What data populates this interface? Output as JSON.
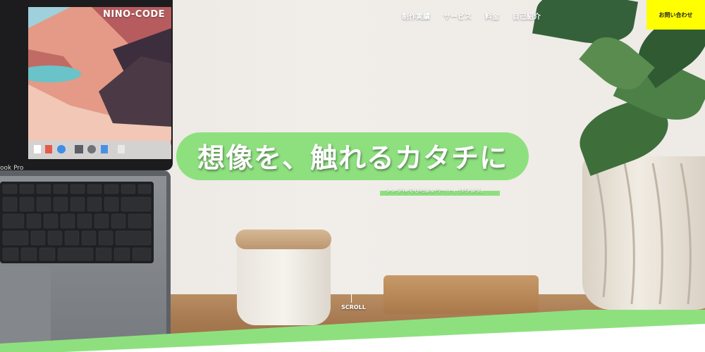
{
  "header": {
    "logo": "NINO-CODE",
    "nav": [
      "制作実績",
      "サービス",
      "料金",
      "自己紹介"
    ],
    "contact_label": "お問い合わせ"
  },
  "hero": {
    "headline": "想像を、触れるカタチに",
    "subline": "シンプルで心地よいサイト、作ります。",
    "scroll_label": "SCROLL",
    "laptop_label": "ook Pro"
  },
  "colors": {
    "accent_green": "#8ee07f",
    "contact_yellow": "#ffff00",
    "text_white": "#ffffff"
  }
}
